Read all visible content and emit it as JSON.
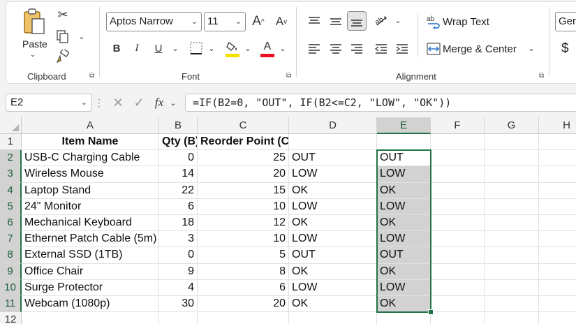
{
  "ribbon": {
    "clipboard": {
      "label": "Clipboard",
      "paste_label": "Paste"
    },
    "font": {
      "label": "Font",
      "font_name": "Aptos Narrow",
      "font_size": "11",
      "bold": "B",
      "italic": "I",
      "underline": "U",
      "grow": "A",
      "shrink": "A",
      "fill_color": "#f5e100",
      "font_color": "#e81123"
    },
    "alignment": {
      "label": "Alignment",
      "wrap_text": "Wrap Text",
      "merge_center": "Merge & Center"
    },
    "number": {
      "format_partial": "Gen",
      "currency_symbol": "$"
    }
  },
  "formula_bar": {
    "name_box": "E2",
    "fx": "fx",
    "formula": "=IF(B2=0, \"OUT\", IF(B2<=C2, \"LOW\", \"OK\"))"
  },
  "sheet": {
    "columns": [
      "A",
      "B",
      "C",
      "D",
      "E",
      "F",
      "G",
      "H"
    ],
    "rows": [
      "1",
      "2",
      "3",
      "4",
      "5",
      "6",
      "7",
      "8",
      "9",
      "10",
      "11",
      "12"
    ],
    "headers": [
      "Item Name",
      "Qty (B)",
      "Reorder Point (C)",
      "",
      ""
    ],
    "data": [
      [
        "USB-C Charging Cable",
        "0",
        "25",
        "OUT",
        "OUT"
      ],
      [
        "Wireless Mouse",
        "14",
        "20",
        "LOW",
        "LOW"
      ],
      [
        "Laptop Stand",
        "22",
        "15",
        "OK",
        "OK"
      ],
      [
        "24\" Monitor",
        "6",
        "10",
        "LOW",
        "LOW"
      ],
      [
        "Mechanical Keyboard",
        "18",
        "12",
        "OK",
        "OK"
      ],
      [
        "Ethernet Patch Cable (5m)",
        "3",
        "10",
        "LOW",
        "LOW"
      ],
      [
        "External SSD (1TB)",
        "0",
        "5",
        "OUT",
        "OUT"
      ],
      [
        "Office Chair",
        "9",
        "8",
        "OK",
        "OK"
      ],
      [
        "Surge Protector",
        "4",
        "6",
        "LOW",
        "LOW"
      ],
      [
        "Webcam (1080p)",
        "30",
        "20",
        "OK",
        "OK"
      ]
    ],
    "accent_color": "#217346"
  }
}
